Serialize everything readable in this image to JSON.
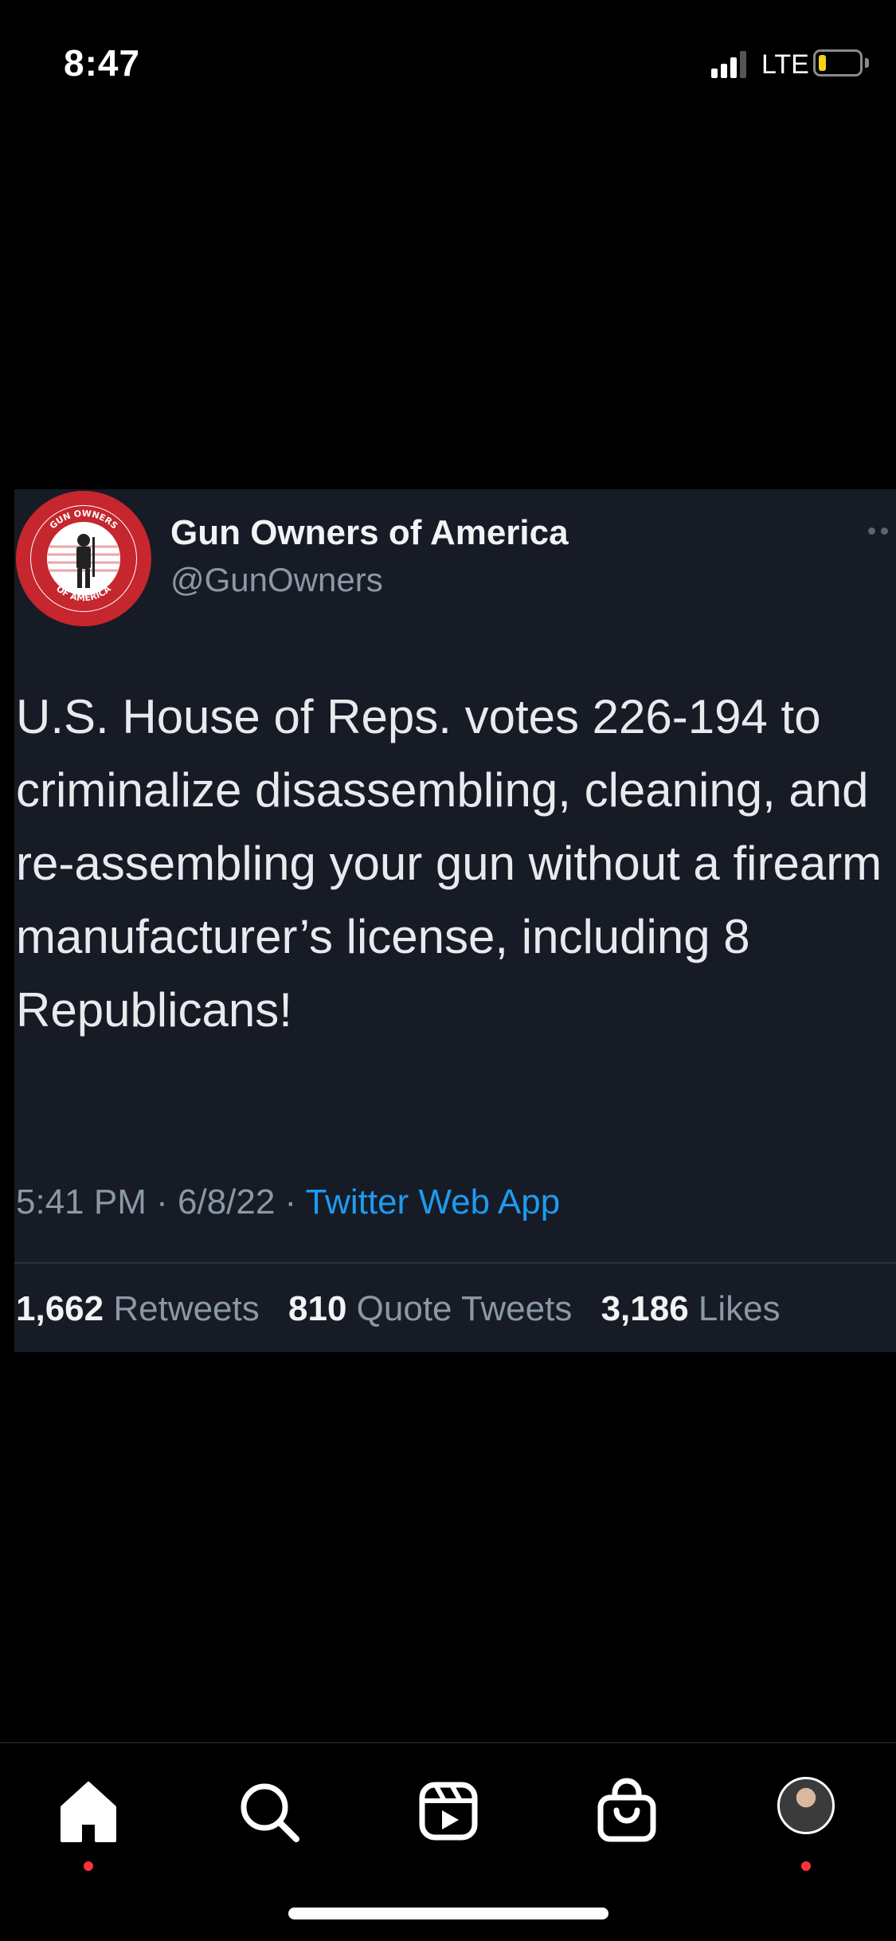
{
  "status_bar": {
    "time": "8:47",
    "network": "LTE"
  },
  "tweet": {
    "author_name": "Gun Owners of America",
    "author_handle": "@GunOwners",
    "avatar_ring_text_top": "GUN OWNERS",
    "avatar_ring_text_bottom": "OF AMERICA",
    "text": "U.S. House of Reps. votes 226-194 to criminalize disassembling, cleaning, and re-assembling your gun without a firearm manufacturer’s license, including 8 Republicans!",
    "time": "5:41 PM",
    "date": "6/8/22",
    "meta_separator": " · ",
    "source": "Twitter Web App",
    "stats": {
      "retweets_count": "1,662",
      "retweets_label": "Retweets",
      "quotes_count": "810",
      "quotes_label": "Quote Tweets",
      "likes_count": "3,186",
      "likes_label": "Likes"
    }
  },
  "bottom_nav": {
    "items": [
      {
        "icon": "home-icon",
        "active": true
      },
      {
        "icon": "search-icon"
      },
      {
        "icon": "reels-icon"
      },
      {
        "icon": "shop-icon"
      },
      {
        "icon": "profile-avatar"
      }
    ]
  },
  "colors": {
    "background": "#000000",
    "card": "#161b25",
    "link": "#1d9bf0",
    "muted": "#8b98a5",
    "notification_dot": "#ff3040",
    "logo_red": "#c6262e"
  }
}
